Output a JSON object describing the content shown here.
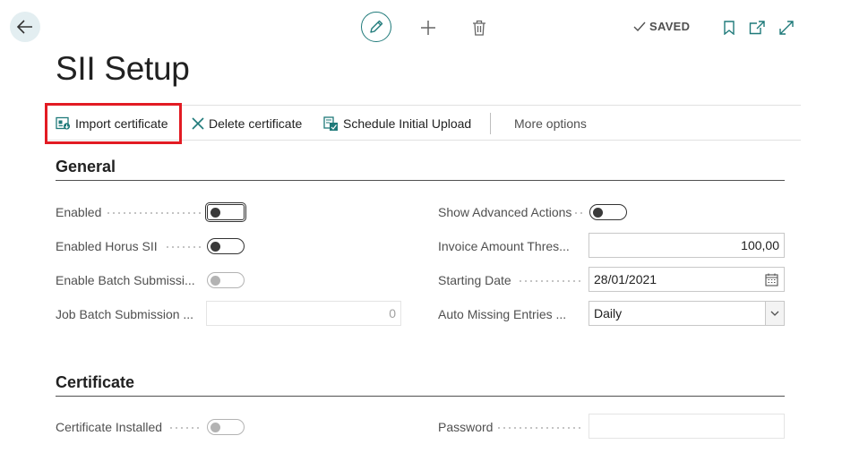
{
  "topbar": {
    "saved_label": "SAVED"
  },
  "page": {
    "title": "SII Setup"
  },
  "actions": {
    "import_certificate": "Import certificate",
    "delete_certificate": "Delete certificate",
    "schedule_initial_upload": "Schedule Initial Upload",
    "more_options": "More options"
  },
  "general": {
    "title": "General",
    "enabled_label": "Enabled",
    "enabled_horus_label": "Enabled Horus SII",
    "batch_submission_label": "Enable Batch Submissi...",
    "job_batch_label": "Job Batch Submission ...",
    "job_batch_value": "0",
    "show_advanced_label": "Show Advanced Actions",
    "invoice_threshold_label": "Invoice Amount Thres...",
    "invoice_threshold_value": "100,00",
    "starting_date_label": "Starting Date",
    "starting_date_value": "28/01/2021",
    "auto_missing_label": "Auto Missing Entries ...",
    "auto_missing_value": "Daily"
  },
  "certificate": {
    "title": "Certificate",
    "installed_label": "Certificate Installed",
    "password_label": "Password",
    "password_value": ""
  },
  "colors": {
    "accent": "#1f7a7a",
    "highlight": "#e21b23"
  }
}
